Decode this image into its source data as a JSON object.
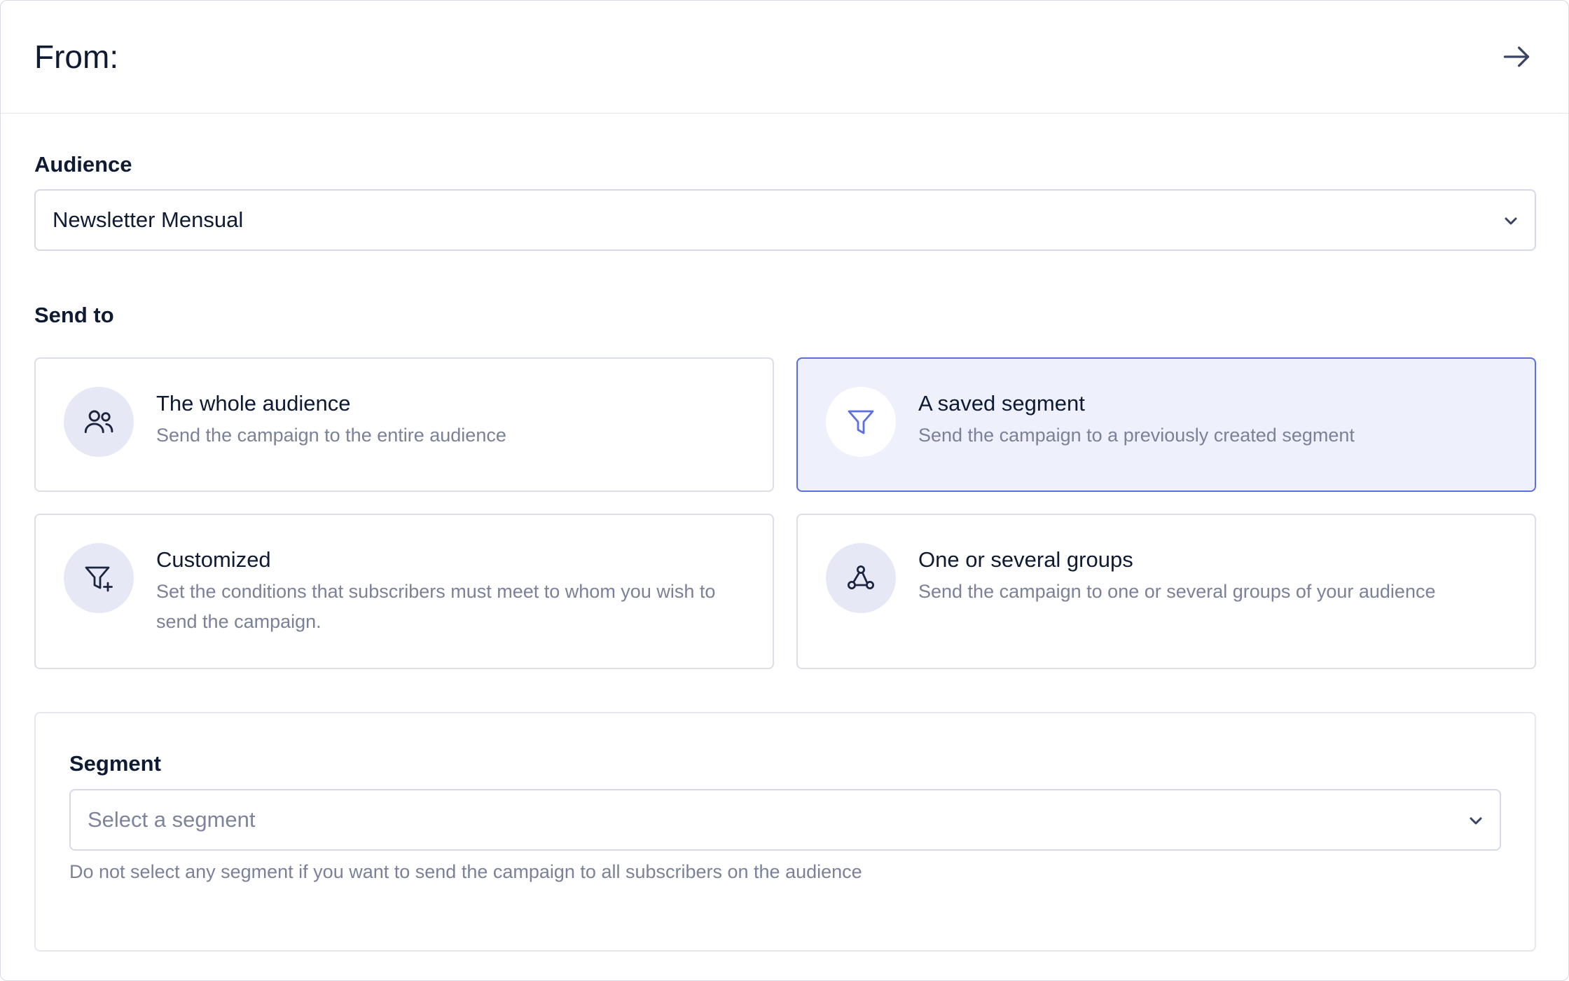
{
  "header": {
    "title": "From:",
    "next_icon": "arrow-right-icon"
  },
  "audience": {
    "label": "Audience",
    "value": "Newsletter Mensual"
  },
  "send_to": {
    "label": "Send to",
    "selected": "saved-segment",
    "options": [
      {
        "id": "whole-audience",
        "icon": "users-icon",
        "title": "The whole audience",
        "description": "Send the campaign to the entire audience"
      },
      {
        "id": "saved-segment",
        "icon": "funnel-icon",
        "title": "A saved segment",
        "description": "Send the campaign to a previously created segment"
      },
      {
        "id": "customized",
        "icon": "funnel-plus-icon",
        "title": "Customized",
        "description": "Set the conditions that subscribers must meet to whom you wish to send the campaign."
      },
      {
        "id": "groups",
        "icon": "nodes-icon",
        "title": "One or several groups",
        "description": "Send the campaign to one or several groups of your audience"
      }
    ]
  },
  "segment": {
    "label": "Segment",
    "placeholder": "Select a segment",
    "help": "Do not select any segment if you want to send the campaign to all subscribers on the audience"
  },
  "colors": {
    "accent": "#5b6fe0",
    "selected_bg": "#eef0fb",
    "text": "#0f1a33",
    "muted": "#7a8198",
    "border": "#d7dae6",
    "icon_bg": "#e6e9f5"
  }
}
